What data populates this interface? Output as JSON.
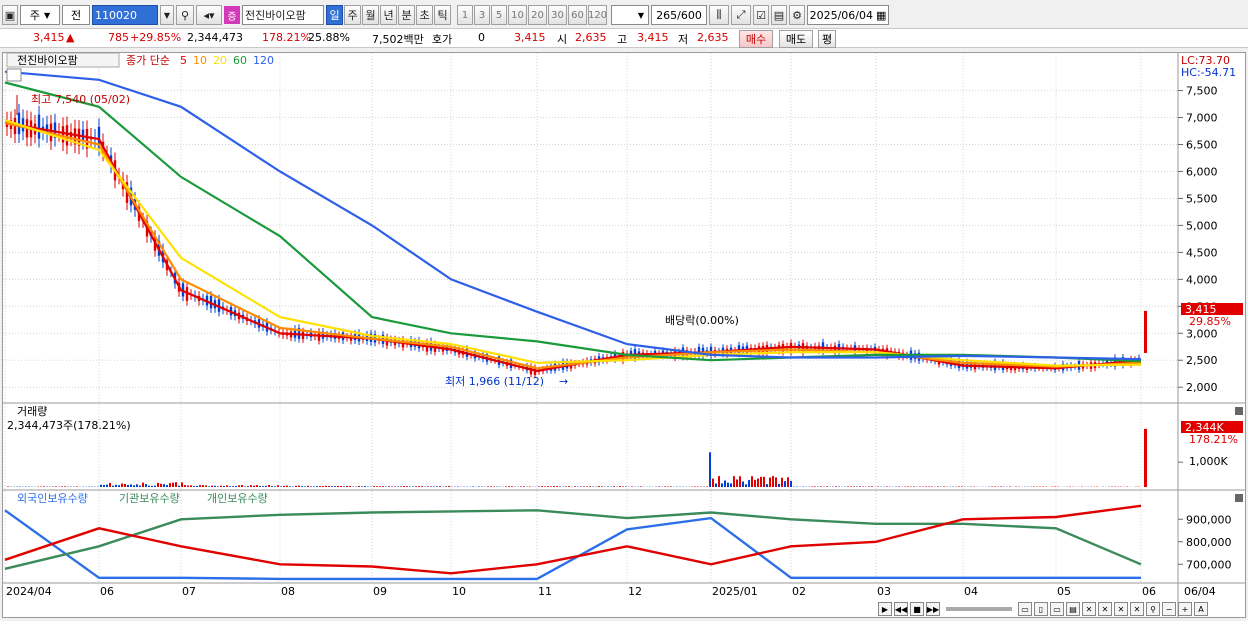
{
  "toolbar": {
    "period_day_label": "주",
    "prev_label": "전",
    "code": "110020",
    "stock_name": "전진바이오팜",
    "badge": "증",
    "period_tabs": [
      "일",
      "주",
      "월",
      "년",
      "분",
      "초",
      "틱"
    ],
    "active_period": "일",
    "minute_options": [
      "1",
      "3",
      "5",
      "10",
      "20",
      "30",
      "60",
      "120"
    ],
    "count": "265",
    "count_max": "/600",
    "date": "2025/06/04"
  },
  "quote": {
    "price": "3,415",
    "change": "785",
    "change_pct": "+29.85%",
    "volume": "2,344,473",
    "volume_ratio": "178.21%",
    "turnover": "25.88%",
    "trade_amount": "7,502백만",
    "hoga_label": "호가",
    "hoga_value": "0",
    "ask_price": "3,415",
    "open_label": "시",
    "open": "2,635",
    "high_label": "고",
    "high": "3,415",
    "low_label": "저",
    "low": "2,635",
    "buy_label": "매수",
    "sell_label": "매도",
    "eval_label": "평"
  },
  "price_panel": {
    "title": "전진바이오팜",
    "legend_prefix": "종가 단순",
    "ma_labels": [
      "5",
      "10",
      "20",
      "60",
      "120"
    ],
    "lc": "LC:73.70",
    "hc": "HC:-54.71",
    "high_note": "최고 7,540 (05/02)",
    "low_note": "최저 1,966 (11/12)",
    "dividend_note": "배당락(0.00%)",
    "last_price": "3,415",
    "last_pct": "29.85%"
  },
  "volume_panel": {
    "title": "거래량",
    "value": "2,344,473주(178.21%)",
    "last": "2,344K",
    "last_pct": "178.21%",
    "tick": "1,000K"
  },
  "holding_panel": {
    "titles": [
      "외국인보유수량",
      "기관보유수량",
      "개인보유수량"
    ]
  },
  "x_axis": [
    "2024/04",
    "06",
    "07",
    "08",
    "09",
    "10",
    "11",
    "12",
    "2025/01",
    "02",
    "03",
    "04",
    "05",
    "06",
    "06/04"
  ],
  "colors": {
    "ma5": "#e00000",
    "ma10": "#ff8c00",
    "ma20": "#ffe000",
    "ma60": "#1a9a3a",
    "ma120": "#2d5fe8",
    "up": "#e00000",
    "down": "#0040d0",
    "foreign": "#2d6fe8",
    "institution": "#3a8a5a",
    "individual": "#e00000"
  },
  "chart_data": [
    {
      "type": "line",
      "name": "price",
      "ylim": [
        1800,
        7900
      ],
      "yticks": [
        "7,500",
        "7,000",
        "6,500",
        "6,000",
        "5,500",
        "5,000",
        "4,500",
        "4,000",
        "3,500",
        "3,000",
        "2,500",
        "2,000"
      ],
      "x": [
        "2024/04",
        "06",
        "07",
        "08",
        "09",
        "10",
        "11",
        "12",
        "2025/01",
        "02",
        "03",
        "04",
        "05",
        "06"
      ],
      "series": [
        {
          "name": "5",
          "values": [
            6900,
            6600,
            3800,
            3000,
            2900,
            2700,
            2300,
            2600,
            2650,
            2750,
            2700,
            2400,
            2350,
            2500
          ]
        },
        {
          "name": "10",
          "values": [
            6900,
            6500,
            4000,
            3100,
            2900,
            2750,
            2350,
            2550,
            2650,
            2700,
            2650,
            2450,
            2380,
            2450
          ]
        },
        {
          "name": "20",
          "values": [
            6950,
            6400,
            4400,
            3300,
            2950,
            2800,
            2450,
            2500,
            2600,
            2650,
            2650,
            2500,
            2400,
            2420
          ]
        },
        {
          "name": "60",
          "values": [
            7650,
            7200,
            5900,
            4800,
            3300,
            3000,
            2850,
            2600,
            2500,
            2550,
            2600,
            2600,
            2550,
            2480
          ]
        },
        {
          "name": "120",
          "values": [
            7850,
            7700,
            7200,
            6000,
            5000,
            4000,
            3400,
            2800,
            2600,
            2550,
            2550,
            2580,
            2550,
            2520
          ]
        }
      ]
    },
    {
      "type": "bar",
      "name": "volume",
      "ylim": [
        0,
        2500
      ],
      "categories": [
        "2024/04",
        "06",
        "07",
        "08",
        "09",
        "10",
        "11",
        "12",
        "2025/01",
        "02",
        "03",
        "04",
        "05",
        "06"
      ],
      "values": [
        80,
        600,
        250,
        180,
        120,
        90,
        110,
        70,
        1400,
        90,
        70,
        60,
        50,
        2344
      ]
    },
    {
      "type": "line",
      "name": "holdings",
      "yticks": [
        "900,000",
        "800,000",
        "700,000"
      ],
      "ylim": [
        630000,
        950000
      ],
      "x": [
        "2024/04",
        "06",
        "07",
        "08",
        "09",
        "10",
        "11",
        "12",
        "2025/01",
        "02",
        "03",
        "04",
        "05",
        "06"
      ],
      "series": [
        {
          "name": "외국인보유수량",
          "values": [
            940000,
            640000,
            640000,
            635000,
            635000,
            635000,
            635000,
            855000,
            905000,
            640000,
            640000,
            640000,
            640000,
            640000
          ]
        },
        {
          "name": "기관보유수량",
          "values": [
            680000,
            780000,
            900000,
            920000,
            930000,
            935000,
            940000,
            905000,
            930000,
            900000,
            880000,
            880000,
            860000,
            700000
          ]
        },
        {
          "name": "개인보유수량",
          "values": [
            720000,
            860000,
            780000,
            700000,
            690000,
            660000,
            700000,
            780000,
            700000,
            780000,
            800000,
            900000,
            910000,
            960000
          ]
        }
      ]
    }
  ]
}
